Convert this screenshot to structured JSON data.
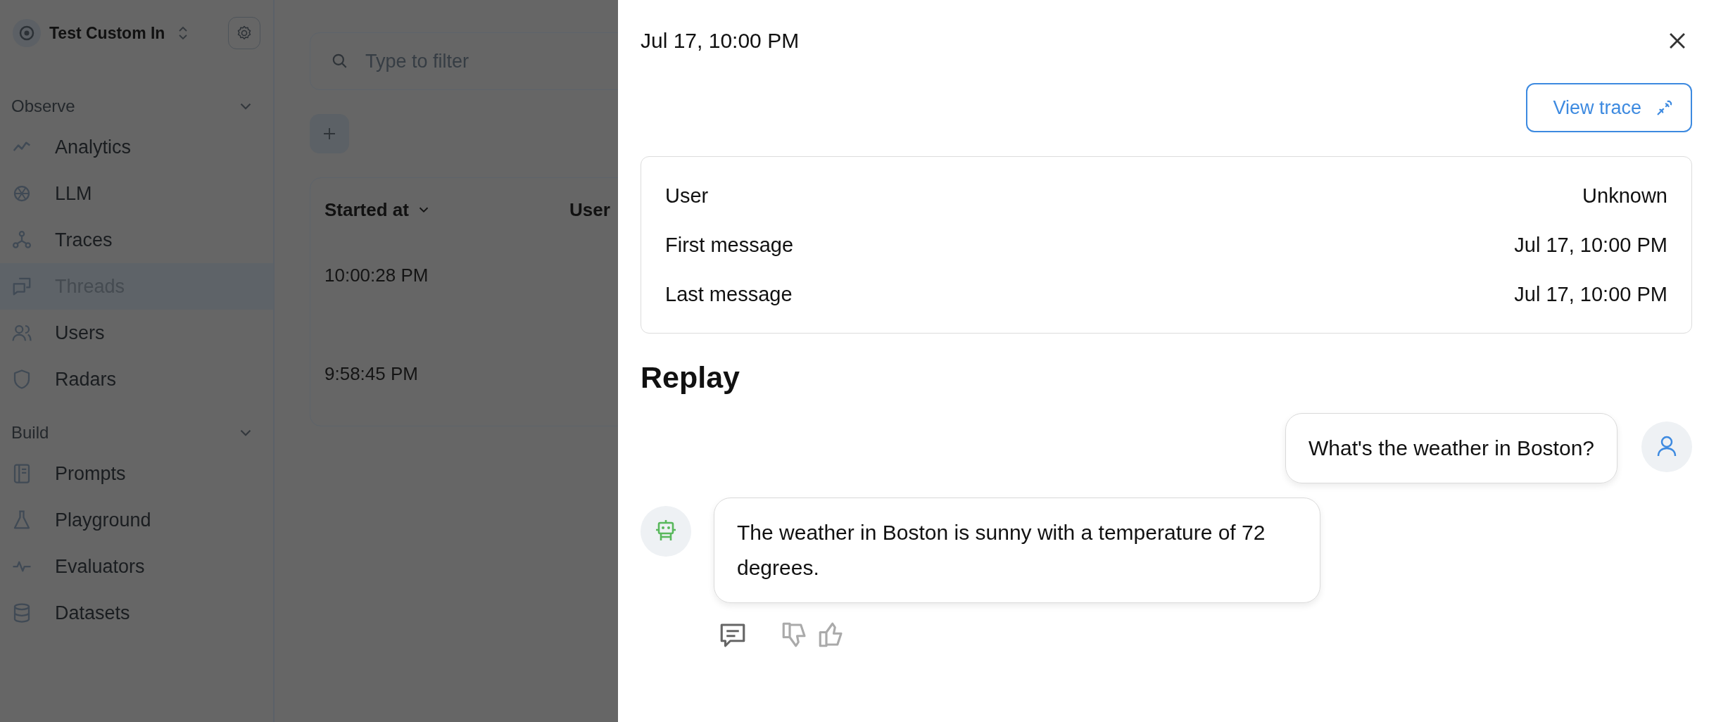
{
  "workspace": {
    "name": "Test Custom In"
  },
  "sidebar": {
    "sections": [
      {
        "title": "Observe",
        "expanded": true,
        "items": [
          {
            "label": "Analytics",
            "selected": false
          },
          {
            "label": "LLM",
            "selected": false
          },
          {
            "label": "Traces",
            "selected": false
          },
          {
            "label": "Threads",
            "selected": true
          },
          {
            "label": "Users",
            "selected": false
          },
          {
            "label": "Radars",
            "selected": false
          }
        ]
      },
      {
        "title": "Build",
        "expanded": true,
        "items": [
          {
            "label": "Prompts",
            "selected": false
          },
          {
            "label": "Playground",
            "selected": false
          },
          {
            "label": "Evaluators",
            "selected": false
          },
          {
            "label": "Datasets",
            "selected": false
          }
        ]
      }
    ]
  },
  "filter": {
    "placeholder": "Type to filter"
  },
  "table": {
    "columns": [
      "Started at",
      "User"
    ],
    "rows": [
      {
        "started_at": "10:00:28 PM"
      },
      {
        "started_at": "9:58:45 PM"
      }
    ]
  },
  "drawer": {
    "title": "Jul 17, 10:00 PM",
    "view_trace": "View trace",
    "details": [
      {
        "label": "User",
        "value": "Unknown"
      },
      {
        "label": "First message",
        "value": "Jul 17, 10:00 PM"
      },
      {
        "label": "Last message",
        "value": "Jul 17, 10:00 PM"
      }
    ],
    "replay_title": "Replay",
    "messages": [
      {
        "kind": "user",
        "text": "What's the weather in Boston?"
      },
      {
        "kind": "assistant",
        "text": "The weather in Boston is sunny with a temperature of 72 degrees."
      }
    ]
  }
}
